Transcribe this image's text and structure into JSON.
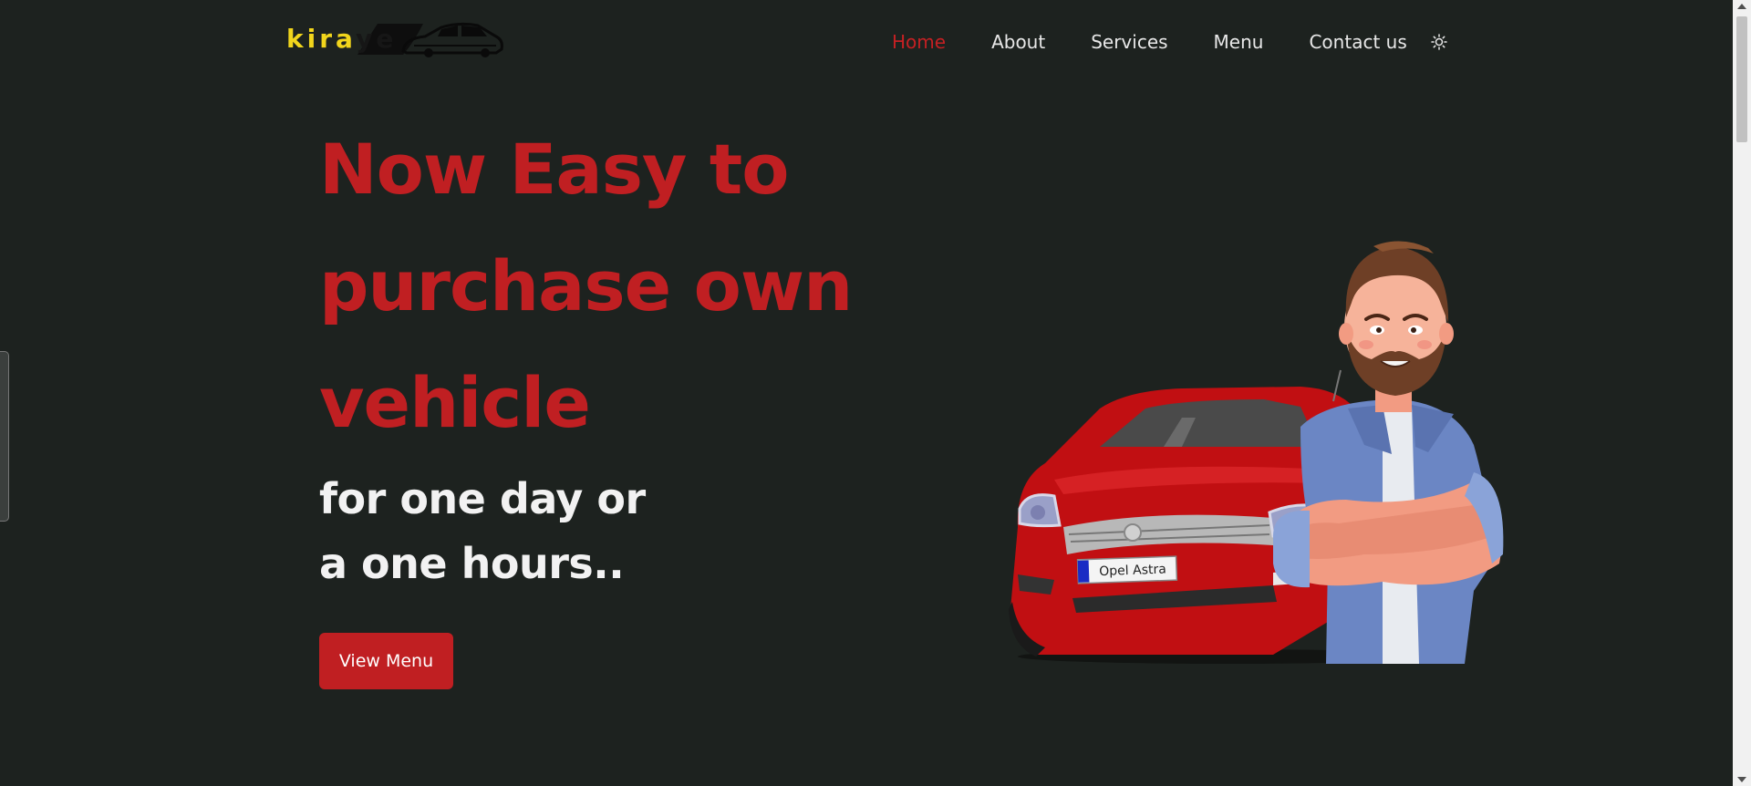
{
  "brand": {
    "logo_part1": "kira",
    "logo_part2": "ye",
    "logo_color": "#f1d51c"
  },
  "nav": {
    "items": [
      {
        "label": "Home",
        "active": true
      },
      {
        "label": "About",
        "active": false
      },
      {
        "label": "Services",
        "active": false
      },
      {
        "label": "Menu",
        "active": false
      },
      {
        "label": "Contact us",
        "active": false
      }
    ],
    "theme_toggle_icon": "sun-icon"
  },
  "hero": {
    "title_lines": [
      "Now Easy to",
      "purchase own",
      "vehicle"
    ],
    "subtitle_lines": [
      "for one day or",
      "a one hours.."
    ],
    "cta_label": "View Menu",
    "plate_text": "Opel Astra"
  },
  "colors": {
    "background": "#1d221f",
    "accent": "#c01f22",
    "text": "#f2f2f2"
  }
}
